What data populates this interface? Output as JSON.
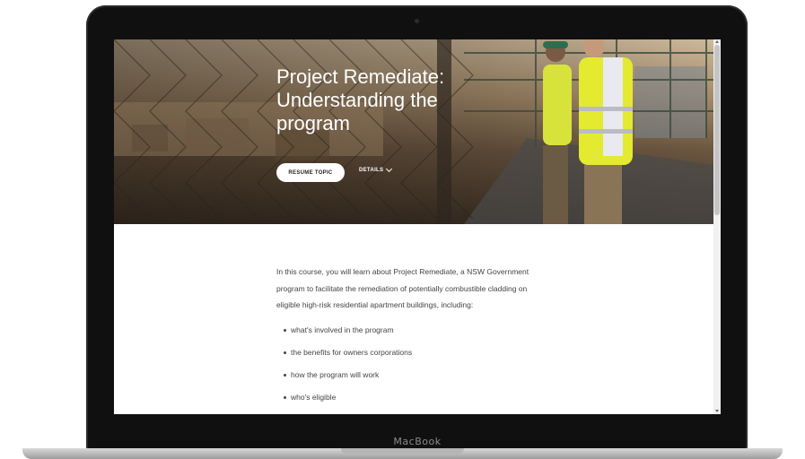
{
  "hero": {
    "title_lines": [
      "Project Remediate:",
      "Understanding the",
      "program"
    ],
    "resume_label": "RESUME TOPIC",
    "details_label": "DETAILS"
  },
  "content": {
    "intro": "In this course, you will learn about Project Remediate, a NSW Government program to facilitate the remediation of potentially combustible cladding on eligible high-risk residential apartment buildings, including:",
    "bullets": [
      "what's involved in the program",
      "the benefits for owners corporations",
      "how the program will work",
      "who's eligible"
    ]
  },
  "device": {
    "brand": "MacBook"
  },
  "icons": {
    "details_chevron": "chevron-down-icon"
  },
  "colors": {
    "button_bg": "#ffffff",
    "body_text": "#444444",
    "frame": "#101010"
  }
}
